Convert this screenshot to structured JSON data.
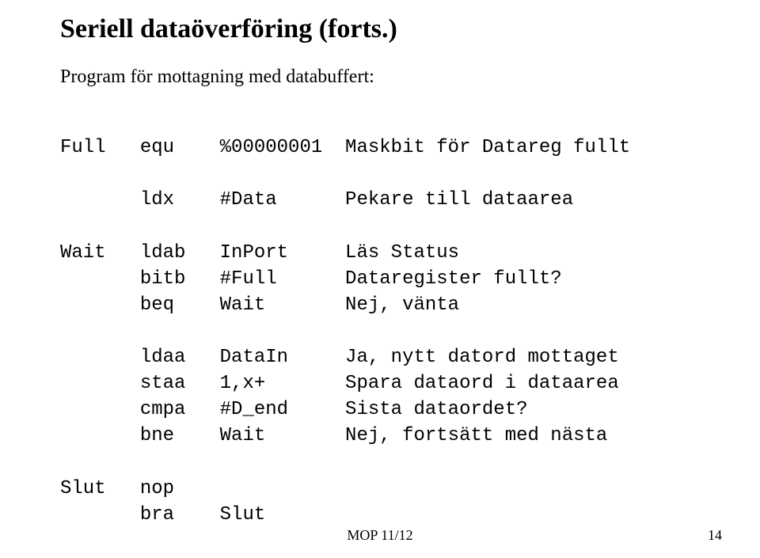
{
  "title": "Seriell dataöverföring (forts.)",
  "subtitle": "Program för mottagning med databuffert:",
  "code": {
    "l1": "Full   equ    %00000001  Maskbit för Datareg fullt",
    "l2": "",
    "l3": "       ldx    #Data      Pekare till dataarea",
    "l4": "",
    "l5": "Wait   ldab   InPort     Läs Status",
    "l6": "       bitb   #Full      Dataregister fullt?",
    "l7": "       beq    Wait       Nej, vänta",
    "l8": "",
    "l9": "       ldaa   DataIn     Ja, nytt datord mottaget",
    "l10": "       staa   1,x+       Spara dataord i dataarea",
    "l11": "       cmpa   #D_end     Sista dataordet?",
    "l12": "       bne    Wait       Nej, fortsätt med nästa",
    "l13": "",
    "l14": "Slut   nop",
    "l15": "       bra    Slut"
  },
  "footer": "MOP 11/12",
  "page": "14"
}
